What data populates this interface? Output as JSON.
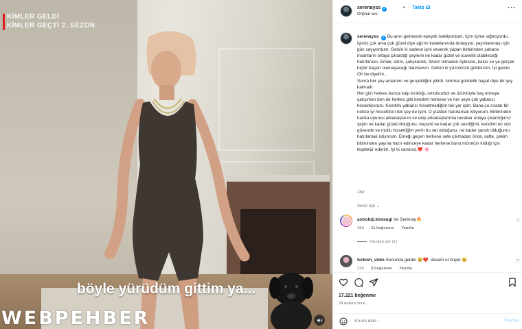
{
  "media": {
    "show_title_line1": "KİMLER GELDİ",
    "show_title_line2": "KİMLER GEÇTİ 2. SEZON",
    "subtitle": "böyle yürüdüm gittim ya...",
    "watermark": "WEBPEHBER",
    "mute_icon": "speaker-muted-icon"
  },
  "header": {
    "username": "serenayss",
    "dot": "•",
    "follow_label": "Takip Et",
    "audio_label": "Orijinal ses",
    "more_icon": "more-horizontal-icon"
  },
  "caption": {
    "username": "serenayss",
    "paragraphs": [
      "Bu anın gelmesini epeydir bekliyordum. İçim içime sığmıyordu. İşimiz çok ama çok güzel diye ağzım kulaklarımda dolaşıyor, yayınlanması için gün sayıyordum. Gelsin ki sadece işini severek yapan birbirinden şahane insanların ortaya çıkardığı şeylerin ne kadar güzel ve kuvvetli olabileceği hatırlansın. Emek, azim, çalışkanlık, özveri olmadan öylesine, kalıcı ve ya gerçek hiçbir başarı olamayacağı hatırlansın. Gelsin ki yüzümüzü güldürsün. İyi gelsin. Oh be diyelim...",
      "Sonra her şey anlamını ve gerçekliğini yitirdi. Normal gündelik hayat diye bir şey kalmadı.",
      "Her gün herkes bunca kalp kırıklığı, umutsuzluk ve üzüntüyle baş etmeye çalışırken ben de herkes gibi kendimi herkese ve her şeye çok yabancı hissediyorum. Kendimi yabancı hissetmediğim tek yer işim. Bana şu sıralar bir nebze iyi hissettiren tek şey de işim. O yüzden hatırlamak istiyorum. Birbirinden harika oyuncu arkadaşlarım ve ekip arkadaşlarımla beraber ortaya çıkardığımız şeyin ne kadar güzel olduğunu, hepsini ne kadar çok sevdiğimi, kendimi en son güvende ve mutlu hissettiğim yerin bu set olduğunu, ne kadar şanslı olduğumu hatırlamak istiyorum. Emeği geçen herkese sete çıkmadan önce, sette, çekim bitiminden yayına hazır edinceye kadar herkese bunu mümkün kıldığı için teşekkür ederim. İyi ki varsınız.❤️ 🌸"
    ],
    "time": "28d"
  },
  "translate_label": "Senin için ⌄",
  "comments": [
    {
      "username": "astroloji.kintsugi",
      "text": "Ve Serenay🔥",
      "time": "18d",
      "likes": "11 beğenme",
      "reply": "Yanıtla"
    },
    {
      "username": "turkish_vidio",
      "text": "Sonunda geldin 🥹❤️. devam et boyle 🥹",
      "time": "23d",
      "likes": "9 beğenme",
      "reply": "Yanıtla"
    }
  ],
  "view_replies": "Yanıtları gör (1)",
  "actions": {
    "like_icon": "heart-icon",
    "comment_icon": "comment-icon",
    "share_icon": "share-icon",
    "save_icon": "bookmark-icon",
    "likes_count": "17.221 beğenme",
    "posted_ago": "28 dakika önce"
  },
  "add_comment": {
    "placeholder": "Yorum ekle...",
    "post_label": "Paylaş"
  },
  "colors": {
    "accent": "#0095f6",
    "brand_red": "#e50914"
  }
}
